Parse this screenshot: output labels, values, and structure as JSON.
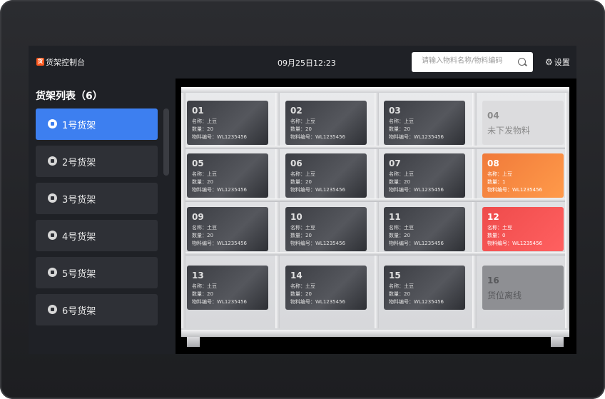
{
  "header": {
    "logo_text": "货",
    "app_title": "货架控制台",
    "datetime": "09月25日12:23",
    "search_placeholder": "请输入物料名称/物料编码",
    "settings_label": "设置"
  },
  "sidebar": {
    "title": "货架列表（6）",
    "items": [
      {
        "label": "1号货架",
        "active": true
      },
      {
        "label": "2号货架",
        "active": false
      },
      {
        "label": "3号货架",
        "active": false
      },
      {
        "label": "4号货架",
        "active": false
      },
      {
        "label": "5号货架",
        "active": false
      },
      {
        "label": "6号货架",
        "active": false
      }
    ]
  },
  "cells": [
    {
      "no": "01",
      "state": "dark",
      "name": "名称：上豆",
      "qty": "数量：20",
      "code": "物料编号：WL1235456"
    },
    {
      "no": "02",
      "state": "dark",
      "name": "名称：上豆",
      "qty": "数量：20",
      "code": "物料编号：WL1235456"
    },
    {
      "no": "03",
      "state": "dark",
      "name": "名称：上豆",
      "qty": "数量：20",
      "code": "物料编号：WL1235456"
    },
    {
      "no": "04",
      "state": "light",
      "message": "未下发物料"
    },
    {
      "no": "05",
      "state": "dark",
      "name": "名称：上豆",
      "qty": "数量：20",
      "code": "物料编号：WL1235456"
    },
    {
      "no": "06",
      "state": "dark",
      "name": "名称：上豆",
      "qty": "数量：20",
      "code": "物料编号：WL1235456"
    },
    {
      "no": "07",
      "state": "dark",
      "name": "名称：上豆",
      "qty": "数量：20",
      "code": "物料编号：WL1235456"
    },
    {
      "no": "08",
      "state": "orange",
      "name": "名称：上豆",
      "qty": "数量：1",
      "code": "物料编号：WL1235456"
    },
    {
      "no": "09",
      "state": "dark",
      "name": "名称：土豆",
      "qty": "数量：20",
      "code": "物料编号：WL1235456"
    },
    {
      "no": "10",
      "state": "dark",
      "name": "名称：土豆",
      "qty": "数量：20",
      "code": "物料编号：WL1235456"
    },
    {
      "no": "11",
      "state": "dark",
      "name": "名称：土豆",
      "qty": "数量：20",
      "code": "物料编号：WL1235456"
    },
    {
      "no": "12",
      "state": "red",
      "name": "名称：土豆",
      "qty": "数量：0",
      "code": "物料编号：WL1235456"
    },
    {
      "no": "13",
      "state": "dark",
      "name": "名称：土豆",
      "qty": "数量：20",
      "code": "物料编号：WL1235456"
    },
    {
      "no": "14",
      "state": "dark",
      "name": "名称：土豆",
      "qty": "数量：20",
      "code": "物料编号：WL1235456"
    },
    {
      "no": "15",
      "state": "dark",
      "name": "名称：土豆",
      "qty": "数量：20",
      "code": "物料编号：WL1235456"
    },
    {
      "no": "16",
      "state": "gray",
      "message": "货位离线"
    }
  ]
}
